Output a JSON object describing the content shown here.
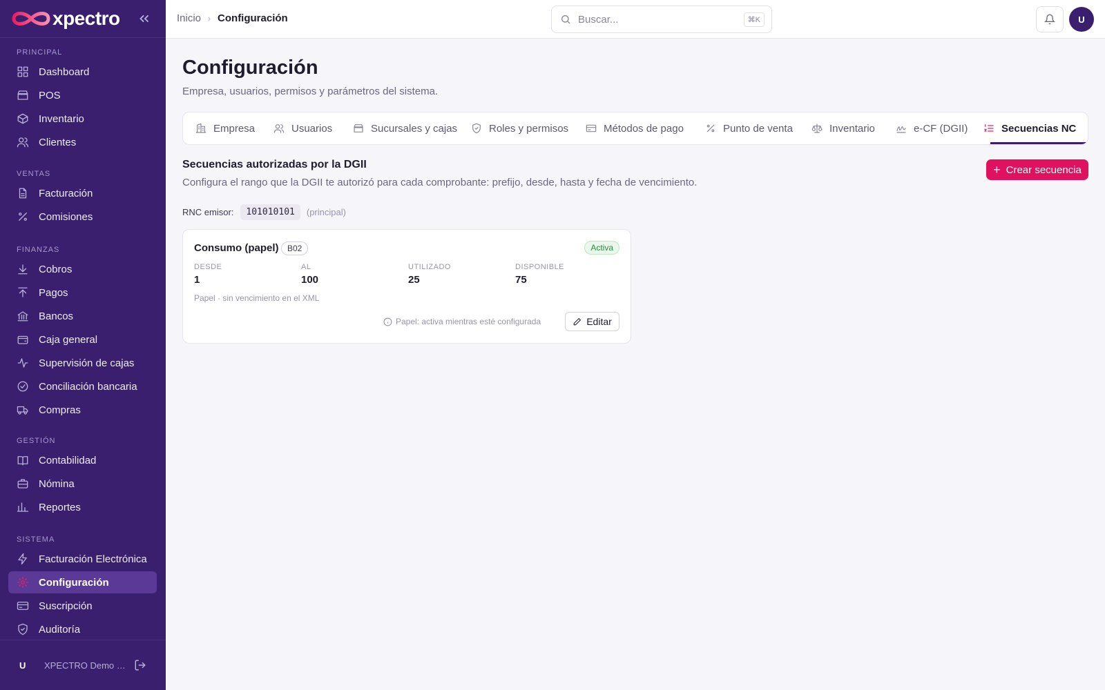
{
  "app": {
    "brand": "xpectro",
    "colors": {
      "sidebar": "#3a1f6e",
      "accent": "#e0115f",
      "active_item": "#5a3a96",
      "status_green": "#2e8b3e"
    }
  },
  "sidebar": {
    "sections": [
      {
        "title": "PRINCIPAL",
        "items": [
          {
            "label": "Dashboard",
            "icon": "grid-icon"
          },
          {
            "label": "POS",
            "icon": "store-icon"
          },
          {
            "label": "Inventario",
            "icon": "box-icon"
          },
          {
            "label": "Clientes",
            "icon": "users-icon"
          }
        ]
      },
      {
        "title": "VENTAS",
        "items": [
          {
            "label": "Facturación",
            "icon": "file-icon"
          },
          {
            "label": "Comisiones",
            "icon": "percent-icon"
          }
        ]
      },
      {
        "title": "FINANZAS",
        "items": [
          {
            "label": "Cobros",
            "icon": "arrow-down-icon"
          },
          {
            "label": "Pagos",
            "icon": "arrow-up-icon"
          },
          {
            "label": "Bancos",
            "icon": "bank-icon"
          },
          {
            "label": "Caja general",
            "icon": "wallet-icon"
          },
          {
            "label": "Supervisión de cajas",
            "icon": "activity-icon"
          },
          {
            "label": "Conciliación bancaria",
            "icon": "check-circle-icon"
          },
          {
            "label": "Compras",
            "icon": "truck-icon"
          }
        ]
      },
      {
        "title": "GESTIÓN",
        "items": [
          {
            "label": "Contabilidad",
            "icon": "book-icon"
          },
          {
            "label": "Nómina",
            "icon": "briefcase-icon"
          },
          {
            "label": "Reportes",
            "icon": "bar-chart-icon"
          }
        ]
      },
      {
        "title": "SISTEMA",
        "items": [
          {
            "label": "Facturación Electrónica",
            "icon": "zap-icon"
          },
          {
            "label": "Configuración",
            "icon": "gear-icon",
            "active": true
          },
          {
            "label": "Suscripción",
            "icon": "credit-card-icon"
          },
          {
            "label": "Auditoría",
            "icon": "shield-icon"
          }
        ]
      }
    ],
    "footer": {
      "avatar": "U",
      "name": "XPECTRO Demo S..."
    }
  },
  "topbar": {
    "breadcrumb": {
      "home": "Inicio",
      "separator": "›",
      "current": "Configuración"
    },
    "search": {
      "placeholder": "Buscar...",
      "shortcut": "⌘K"
    },
    "avatar": "U"
  },
  "page": {
    "title": "Configuración",
    "subtitle": "Empresa, usuarios, permisos y parámetros del sistema."
  },
  "tabs": [
    {
      "label": "Empresa",
      "icon": "building-icon"
    },
    {
      "label": "Usuarios",
      "icon": "users-icon"
    },
    {
      "label": "Sucursales y cajas",
      "icon": "store-icon"
    },
    {
      "label": "Roles y permisos",
      "icon": "shield-icon"
    },
    {
      "label": "Métodos de pago",
      "icon": "credit-card-icon"
    },
    {
      "label": "Punto de venta",
      "icon": "percent-icon"
    },
    {
      "label": "Inventario",
      "icon": "scale-icon"
    },
    {
      "label": "e-CF (DGII)",
      "icon": "signature-icon"
    },
    {
      "label": "Secuencias NC",
      "icon": "list-ordered-icon",
      "active": true
    }
  ],
  "section": {
    "title": "Secuencias autorizadas por la DGII",
    "description": "Configura el rango que la DGII te autorizó para cada comprobante: prefijo, desde, hasta y fecha de vencimiento.",
    "create_button": "Crear secuencia",
    "rnc": {
      "label": "RNC emisor:",
      "value": "101010101",
      "note": "(principal)"
    }
  },
  "sequence_card": {
    "title": "Consumo (papel)",
    "code": "B02",
    "status": "Activa",
    "stats": [
      {
        "label": "DESDE",
        "value": "1"
      },
      {
        "label": "AL",
        "value": "100"
      },
      {
        "label": "UTILIZADO",
        "value": "25"
      },
      {
        "label": "DISPONIBLE",
        "value": "75"
      }
    ],
    "footnote": "Papel · sin vencimiento en el XML",
    "hint": "Papel: activa mientras esté configurada",
    "edit_button": "Editar"
  }
}
